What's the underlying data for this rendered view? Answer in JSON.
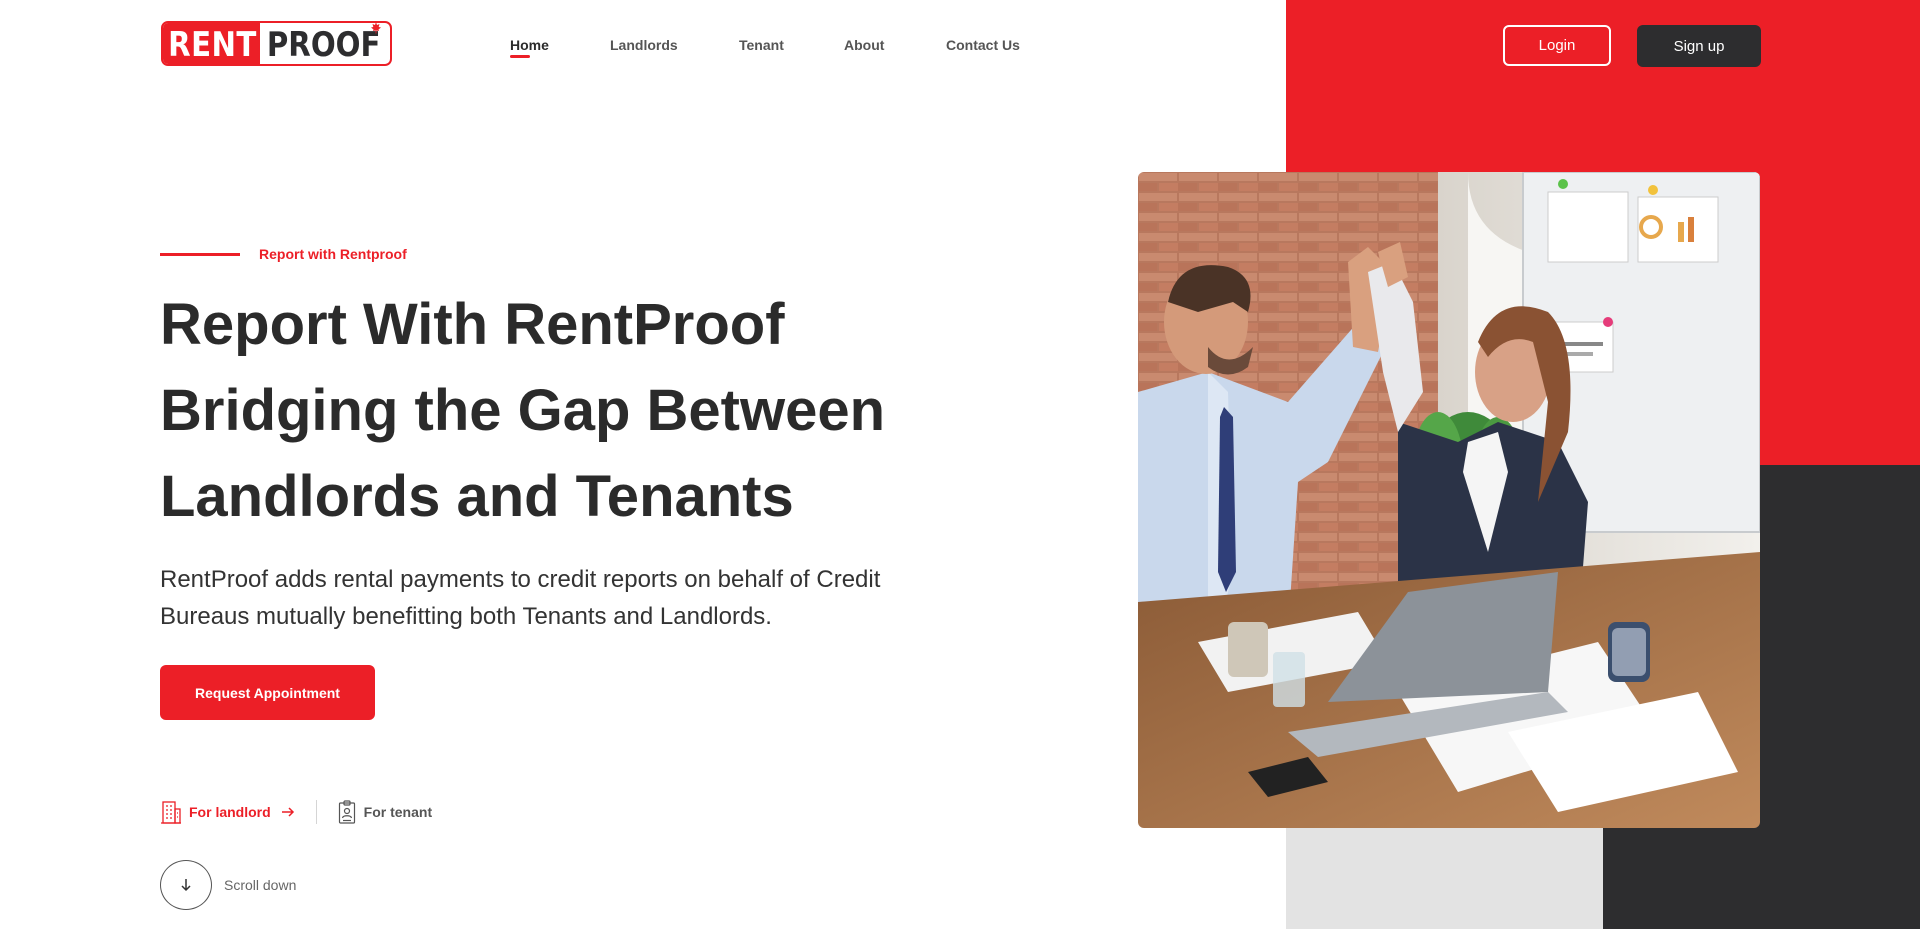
{
  "brand": {
    "logo_left": "RENT",
    "logo_right": "PROOF",
    "accent": "#ec1f27",
    "dark": "#2d2d2f"
  },
  "nav": {
    "items": [
      {
        "label": "Home",
        "active": true
      },
      {
        "label": "Landlords",
        "active": false
      },
      {
        "label": "Tenant",
        "active": false
      },
      {
        "label": "About",
        "active": false
      },
      {
        "label": "Contact Us",
        "active": false
      }
    ]
  },
  "auth": {
    "login_label": "Login",
    "signup_label": "Sign up"
  },
  "hero": {
    "eyebrow": "Report with Rentproof",
    "headline_line1": "Report With RentProof",
    "headline_line2": "Bridging the Gap Between",
    "headline_line3": "Landlords and Tenants",
    "subtext": "RentProof adds rental payments to credit reports on behalf of Credit Bureaus mutually benefitting both Tenants and Landlords.",
    "cta_label": "Request Appointment"
  },
  "roles": {
    "landlord_label": "For landlord",
    "tenant_label": "For tenant",
    "landlord_icon": "building-icon",
    "tenant_icon": "id-badge-icon"
  },
  "scroll": {
    "label": "Scroll down",
    "icon": "arrow-down-icon"
  }
}
